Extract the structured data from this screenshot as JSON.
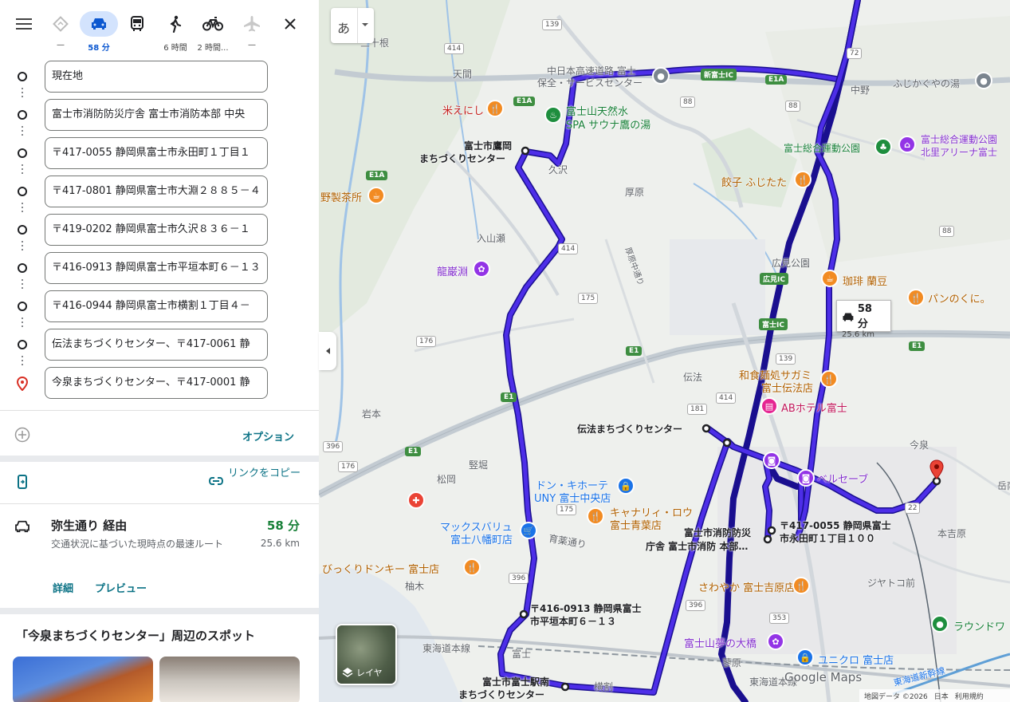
{
  "modes": [
    {
      "id": "best",
      "label": "—",
      "icon": "diamond-route-icon"
    },
    {
      "id": "car",
      "label": "58 分",
      "icon": "car-icon",
      "active": true
    },
    {
      "id": "transit",
      "label": "",
      "icon": "bus-icon"
    },
    {
      "id": "walk",
      "label": "6 時間",
      "icon": "walk-icon"
    },
    {
      "id": "bike",
      "label": "2 時間...",
      "icon": "bike-icon"
    },
    {
      "id": "flight",
      "label": "—",
      "icon": "plane-icon"
    }
  ],
  "waypoints": [
    "現在地",
    "富士市消防防災庁舎 富士市消防本部 中央",
    "〒417-0055 静岡県富士市永田町１丁目１",
    "〒417-0801 静岡県富士市大淵２８８５－４",
    "〒419-0202 静岡県富士市久沢８３６－１",
    "〒416-0913 静岡県富士市平垣本町６－１３",
    "〒416-0944 静岡県富士市横割１丁目４－",
    "伝法まちづくりセンター、〒417-0061 静",
    "今泉まちづくりセンター、〒417-0001 静"
  ],
  "options_label": "オプション",
  "copy_link_label": "リンクをコピー",
  "route": {
    "title": "弥生通り 経由",
    "time": "58 分",
    "desc": "交通状況に基づいた現時点の最速ルート",
    "distance": "25.6 km",
    "details_label": "詳細",
    "preview_label": "プレビュー"
  },
  "spots_title": "「今泉まちづくりセンター」周辺のスポット",
  "map": {
    "lang_label": "あ",
    "badge_time": "58 分",
    "badge_distance": "25.6 km",
    "layer_label": "レイヤ",
    "logo": "Google Maps",
    "footer_data": "地図データ ©2026",
    "footer_country": "日本",
    "footer_terms": "利用規約",
    "route_color": "#3d1fe0",
    "labels": {
      "tenma": "天間",
      "saitoneone": "三十根",
      "komeenishi": "米えにし",
      "nakanihon": "中日本高速道路 富士",
      "hozen": "保全・サービスセンター",
      "onsen1": "富士山天然水",
      "onsen2": "SPA サウナ鷹の湯",
      "takaoka1": "富士市鷹岡",
      "takaoka2": "まちづくりセンター",
      "kuzawa": "久沢",
      "atsuhara": "厚原",
      "seicha": "野製茶所",
      "iriyamase": "入山瀬",
      "ryuganbuchi": "龍巌淵",
      "shinfuji_ic": "新富士IC",
      "nakano": "中野",
      "fujikaguya": "ふじかぐやの湯",
      "sogo_park": "富士総合運動公園",
      "sogo1": "富士総合運動公園",
      "sogo2": "北里アリーナ富士",
      "gyoza": "餃子 ふじたた",
      "hiromi_park": "広見公園",
      "hiromi_ic": "広見IC",
      "coffee": "珈琲 蘭豆",
      "pan": "パンのくに。",
      "fuji_ic": "富士IC",
      "iwamoto": "岩本",
      "denbo": "伝法",
      "sagami1": "和食麺処サガミ",
      "sagami2": "富士伝法店",
      "abhotel": "ABホテル富士",
      "denbo_center": "伝法まちづくりセンター",
      "imaizumi": "今泉",
      "katabori": "竪堀",
      "matsuoka": "松岡",
      "donki1": "ドン・キホーテ",
      "donki2": "UNY 富士中央店",
      "canary1": "キャナリィ・ロウ",
      "canary2": "富士青葉店",
      "maxvalu1": "マックスバリュ",
      "maxvalu2": "富士八幡町店",
      "bikkuri": "びっくりドンキー 富士店",
      "yuzuki": "柚木",
      "ikuhara": "育薬通り",
      "bellsave": "ベルセーブ",
      "motoyoshiwara": "本吉原",
      "shobo1": "富士市消防防災",
      "shobo2": "庁舎 富士市消防 本部…",
      "nagata1": "〒417-0055 静岡県富士",
      "nagata2": "市永田町１丁目１００",
      "jiyatoko": "ジヤトコ前",
      "sawayaka": "さわやか 富士吉原店",
      "heigaki1": "〒416-0913 静岡県富士",
      "heigaki2": "市平垣本町６－１３",
      "tokaido": "東海道本線",
      "fuji_st": "富士",
      "yume": "富士山夢の大橋",
      "uniqlo": "ユニクロ 富士店",
      "round": "ラウンドワ",
      "tokaido2": "東海道本線",
      "shinkansen": "東海道新幹線",
      "ekinan1": "富士市富士駅南",
      "ekinan2": "まちづくりセンター",
      "yokowari": "横割",
      "teibori": "蓼原",
      "gakunan": "岳南",
      "nakagosi": "厚原中通り"
    }
  }
}
